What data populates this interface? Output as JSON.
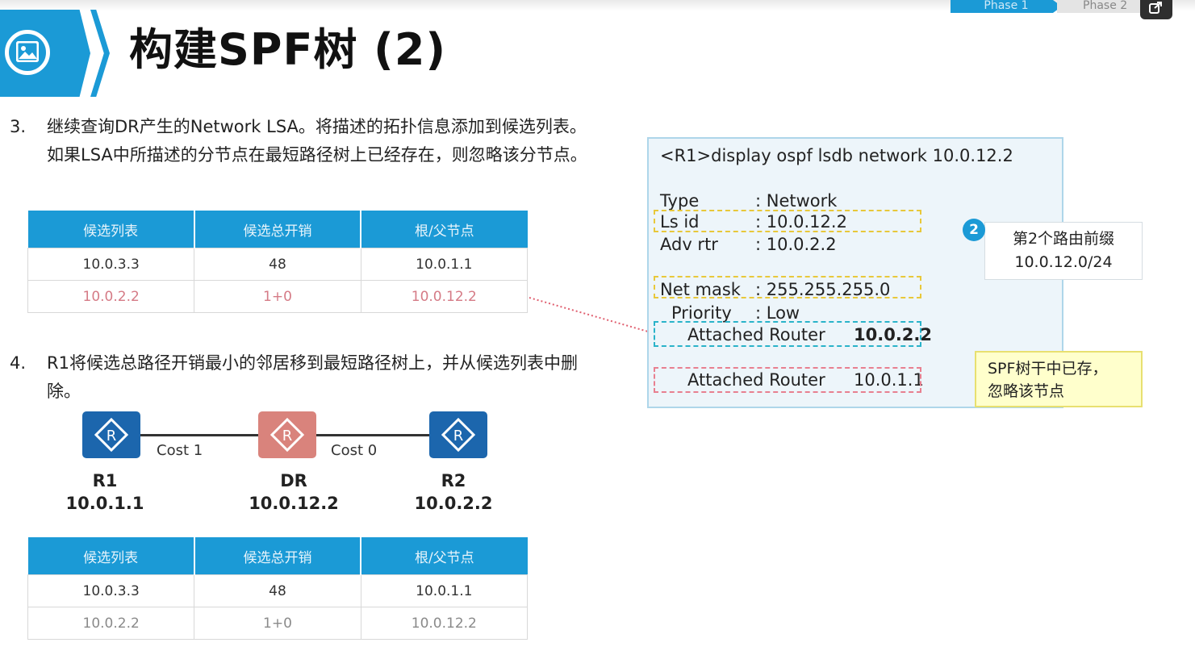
{
  "header": {
    "title": "构建SPF树 (2)",
    "icon": "image-icon",
    "phases": [
      "Phase 1",
      "Phase 2"
    ],
    "share_icon": "share-icon"
  },
  "steps": [
    {
      "num": "3.",
      "text": "继续查询DR产生的Network LSA。将描述的拓扑信息添加到候选列表。如果LSA中所描述的分节点在最短路径树上已经存在，则忽略该分节点。"
    },
    {
      "num": "4.",
      "text": "R1将候选总路径开销最小的邻居移到最短路径树上，并从候选列表中删除。"
    }
  ],
  "table1": {
    "headers": [
      "候选列表",
      "候选总开销",
      "根/父节点"
    ],
    "rows": [
      [
        "10.0.3.3",
        "48",
        "10.0.1.1"
      ],
      [
        "10.0.2.2",
        "1+0",
        "10.0.12.2"
      ]
    ]
  },
  "table2": {
    "headers": [
      "候选列表",
      "候选总开销",
      "根/父节点"
    ],
    "rows": [
      [
        "10.0.3.3",
        "48",
        "10.0.1.1"
      ],
      [
        "10.0.2.2",
        "1+0",
        "10.0.12.2"
      ]
    ]
  },
  "topology": {
    "routers": [
      {
        "name": "R1",
        "ip": "10.0.1.1",
        "color": "#1c66ad"
      },
      {
        "name": "DR",
        "ip": "10.0.12.2",
        "color": "#d9837c"
      },
      {
        "name": "R2",
        "ip": "10.0.2.2",
        "color": "#1c66ad"
      }
    ],
    "links": [
      {
        "label": "Cost 1"
      },
      {
        "label": "Cost 0"
      }
    ]
  },
  "cli": {
    "command": "<R1>display ospf lsdb network 10.0.12.2",
    "fields": [
      {
        "key": "Type",
        "value": ": Network"
      },
      {
        "key": "Ls id",
        "value": ": 10.0.12.2"
      },
      {
        "key": "Adv rtr",
        "value": ": 10.0.2.2"
      },
      {
        "key": "Net mask",
        "value": ": 255.255.255.0"
      },
      {
        "key": "Priority",
        "value": ": Low"
      }
    ],
    "attached": [
      {
        "label": "Attached Router",
        "value": "10.0.2.2"
      },
      {
        "label": "Attached Router",
        "value": "10.0.1.1"
      }
    ]
  },
  "callouts": {
    "badge": "2",
    "prefix_line1": "第2个路由前缀",
    "prefix_line2": "10.0.12.0/24",
    "exist_line1": "SPF树干中已存，",
    "exist_line2": "忽略该节点"
  },
  "colors": {
    "brand_blue": "#1b9ad6",
    "router_blue": "#1c66ad",
    "router_dr": "#d9837c",
    "highlight_pink": "#d57b86",
    "dash_yellow": "#e8c83a",
    "dash_cyan": "#2ab3c9",
    "dash_pink": "#e88090"
  }
}
